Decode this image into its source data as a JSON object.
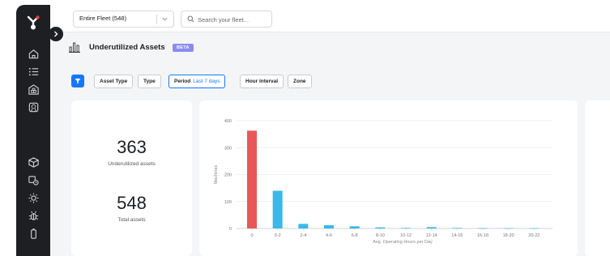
{
  "topbar": {
    "fleet_select": "Entire Fleet (548)",
    "search_placeholder": "Search your fleet..."
  },
  "page": {
    "title": "Underutilized Assets",
    "badge": "BETA"
  },
  "filters": {
    "asset_type": "Asset Type",
    "type": "Type",
    "period_label": "Period",
    "period_value": "Last 7 days",
    "hour_interval": "Hour interval",
    "zone": "Zone"
  },
  "stats": {
    "underutilized_value": "363",
    "underutilized_label": "Underutilized assets",
    "total_value": "548",
    "total_label": "Total assets"
  },
  "sidebar": {
    "icons": [
      "home-icon",
      "list-icon",
      "warehouse-icon",
      "check-badge-icon",
      "cube-icon",
      "truck-timer-icon",
      "sun-icon",
      "bug-icon",
      "battery-icon"
    ]
  },
  "colors": {
    "primary": "#1677ff",
    "badge": "#8b8cf0",
    "bar_highlight": "#e85858",
    "bar_default": "#3ab8ea"
  },
  "chart_data": {
    "type": "bar",
    "categories": [
      "0",
      "0-2",
      "2-4",
      "4-6",
      "6-8",
      "8-10",
      "10-12",
      "12-14",
      "14-16",
      "16-18",
      "18-20",
      "20-22"
    ],
    "values": [
      363,
      140,
      17,
      12,
      8,
      4,
      2,
      5,
      2,
      1,
      1,
      1
    ],
    "xlabel": "Avg. Operating Hours per Day",
    "ylabel": "Machines",
    "yticks": [
      "0",
      "100",
      "200",
      "300",
      "400"
    ],
    "ylim": [
      0,
      400
    ],
    "grid": true,
    "highlight_index": 0
  }
}
